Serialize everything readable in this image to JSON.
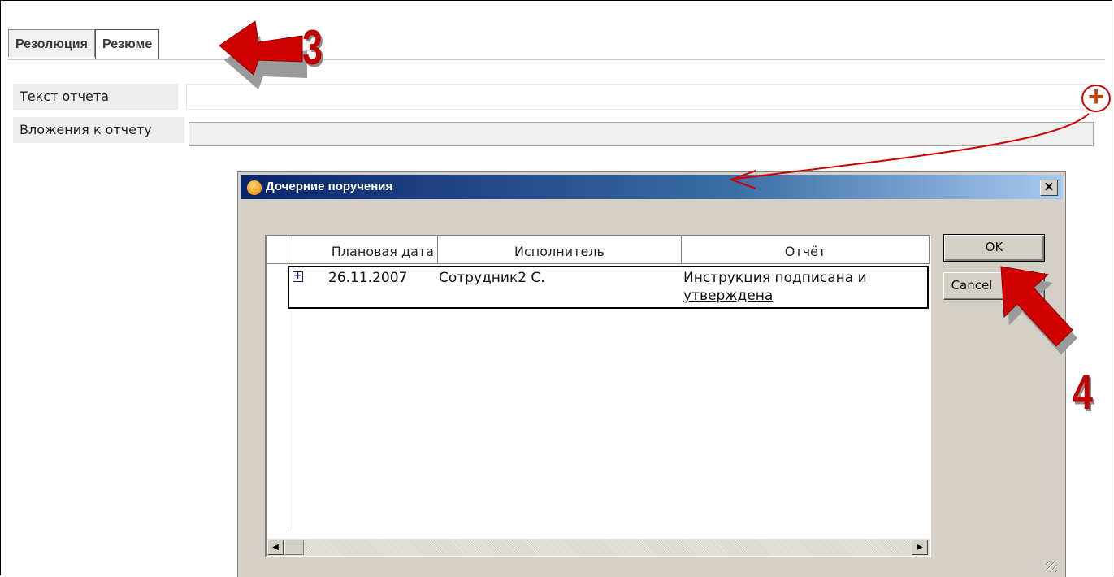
{
  "tabs": [
    {
      "label": "Резолюция",
      "active": false
    },
    {
      "label": "Резюме",
      "active": true
    }
  ],
  "form": {
    "report_text_label": "Текст отчета",
    "report_text_value": "",
    "attachments_label": "Вложения к отчету",
    "attachments_value": ""
  },
  "dialog": {
    "title": "Дочерние поручения",
    "close_glyph": "✕",
    "grid": {
      "columns": [
        "Плановая дата",
        "Исполнитель",
        "Отчёт"
      ],
      "rows": [
        {
          "expand_glyph": "+",
          "date": "26.11.2007",
          "executor": "Сотрудник2 С.",
          "report_line1": "Инструкция подписана и",
          "report_line2": "утверждена"
        }
      ]
    },
    "ok_label": "OK",
    "cancel_label": "Cancel"
  },
  "annotations": {
    "step3": "3",
    "step4": "4",
    "plus": "+"
  },
  "colors": {
    "accent_red": "#d10000",
    "titlebar_start": "#0a246a",
    "titlebar_end": "#a6caf0",
    "dialog_bg": "#d4d0c8"
  },
  "icons": [
    "dialog-app-icon",
    "close-icon",
    "expand-icon",
    "arrow-left-icon",
    "arrow-right-icon",
    "resize-grip-icon",
    "plus-icon"
  ]
}
